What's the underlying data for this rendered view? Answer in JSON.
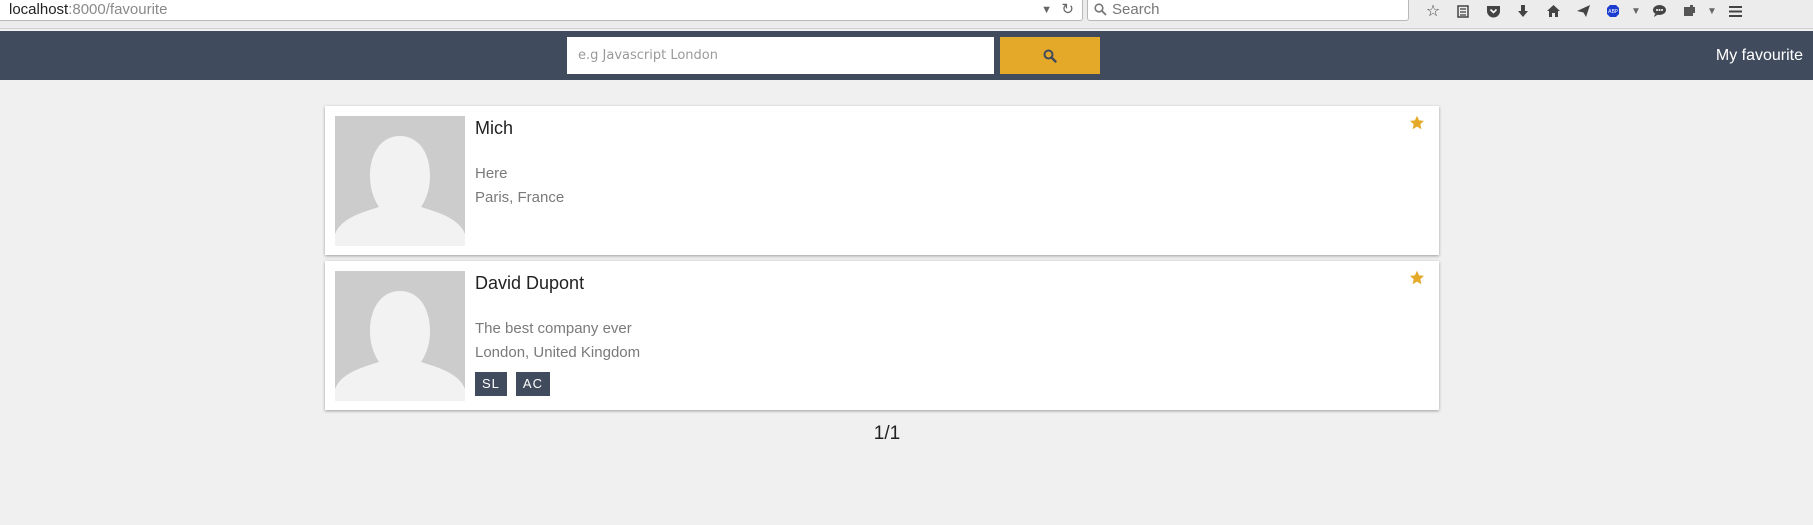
{
  "browser": {
    "url_host": "localhost",
    "url_path": ":8000/favourite",
    "search_placeholder": "Search",
    "toolbar_icons": [
      "star-icon",
      "reading-list-icon",
      "pocket-icon",
      "download-icon",
      "home-icon",
      "send-icon",
      "abp-icon",
      "chevron-down-icon",
      "chat-icon",
      "extension-icon",
      "chevron-down-icon",
      "menu-icon"
    ]
  },
  "header": {
    "search_placeholder": "e.g Javascript London",
    "search_button_icon": "search-icon",
    "favourite_link": "My favourite",
    "background_color": "#414b5e",
    "accent_color": "#e4a928"
  },
  "results": [
    {
      "name": "Mich",
      "company": "Here",
      "location": "Paris, France",
      "tags": [],
      "favourite": true
    },
    {
      "name": "David Dupont",
      "company": "The best company ever",
      "location": "London, United Kingdom",
      "tags": [
        "SL",
        "AC"
      ],
      "favourite": true
    }
  ],
  "pagination": {
    "text": "1/1"
  }
}
